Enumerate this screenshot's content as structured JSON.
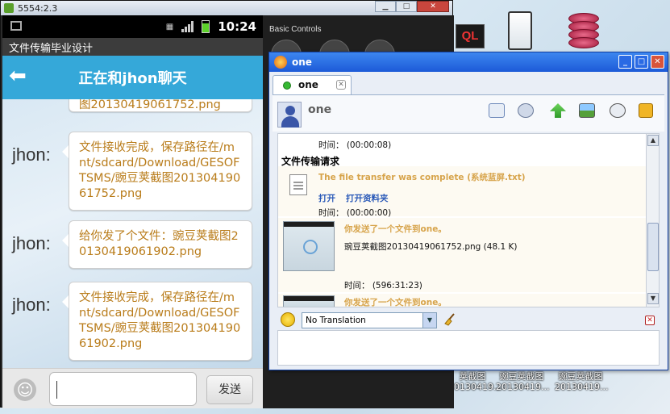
{
  "emulator": {
    "window_title": "5554:2.3",
    "basic_controls_label": "Basic Controls",
    "status_time": "10:24",
    "app_title": "文件传输毕业设计",
    "chat_header_title": "正在和jhon聊天",
    "top_partial_text": "图20130419061752.png",
    "messages": [
      {
        "sender": "jhon:",
        "text": "文件接收完成，保存路径在/mnt/sdcard/Download/GESOFTSMS/豌豆荚截图20130419061752.png"
      },
      {
        "sender": "jhon:",
        "text": "给你发了个文件：豌豆荚截图20130419061902.png"
      },
      {
        "sender": "jhon:",
        "text": "文件接收完成，保存路径在/mnt/sdcard/Download/GESOFTSMS/豌豆荚截图20130419061902.png"
      }
    ],
    "send_button_label": "发送"
  },
  "im": {
    "window_title": "one",
    "tab_label": "one",
    "contact_name": "one",
    "history": {
      "time1": "时间：  (00:00:08)",
      "heading": "文件传输请求",
      "complete_msg": "The file transfer was complete (系统蓝屏.txt)",
      "open_link": "打开",
      "open_folder_link": "打开资料夹",
      "time2": "时间：  (00:00:00)",
      "sent_msg": "你发送了一个文件到one。",
      "file_name": "豌豆荚截图20130419061752.png (48.1 K)",
      "time3": "时间：  (596:31:23)",
      "sent_msg_2": "你发送了一个文件到one。"
    },
    "translation_option": "No Translation"
  },
  "desktop": {
    "ql_label": "QL",
    "thumb_labels": [
      "荚截图",
      "豌豆荚截图",
      "豌豆荚截图"
    ],
    "thumb_sublabels": [
      "20130419...",
      "20130419...",
      "20130419..."
    ]
  }
}
